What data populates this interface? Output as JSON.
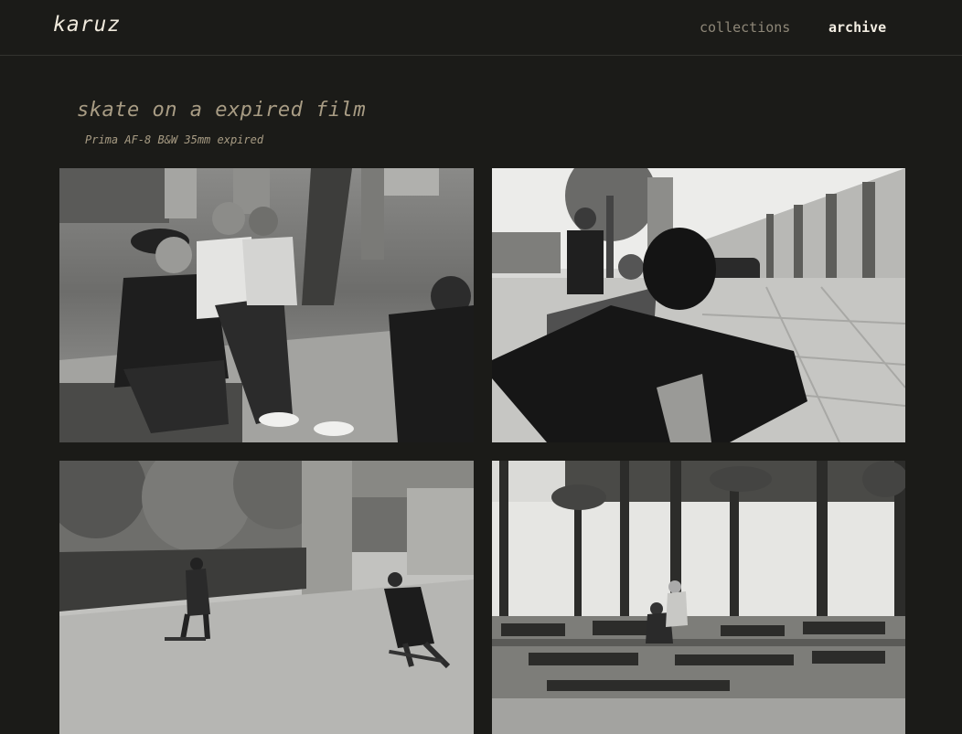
{
  "header": {
    "logo": "karuz",
    "nav": {
      "collections_label": "collections",
      "archive_label": "archive"
    }
  },
  "gallery": {
    "title": "skate on a expired film",
    "subtitle": "Prima AF-8 B&W 35mm expired"
  },
  "colors": {
    "background": "#1b1b18",
    "title": "#a89c84",
    "nav_active": "#f3eee3",
    "nav_inactive": "#8e8778"
  },
  "photos": [
    {
      "name": "photo-group-sitting"
    },
    {
      "name": "photo-hooded-plaza"
    },
    {
      "name": "photo-skating-park"
    },
    {
      "name": "photo-graffiti-wall"
    }
  ]
}
